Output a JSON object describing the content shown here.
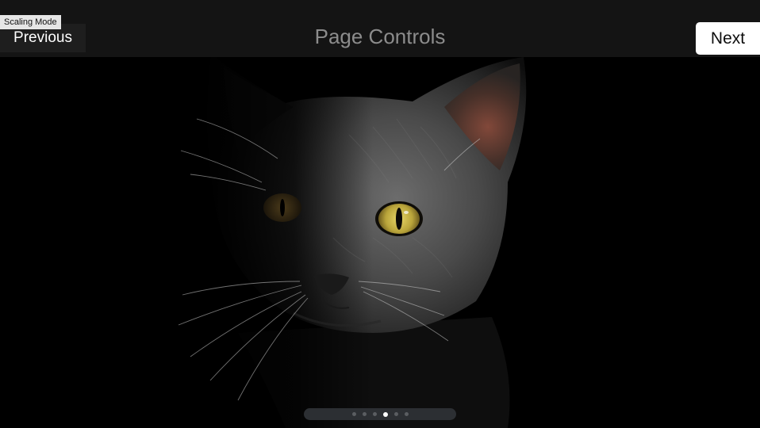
{
  "header": {
    "scaling_mode_label": "Scaling Mode",
    "title": "Page Controls",
    "previous_label": "Previous",
    "next_label": "Next"
  },
  "photo": {
    "subject": "black-cat-photo"
  },
  "page_indicator": {
    "page_count": 6,
    "current_page": 4
  },
  "colors": {
    "header_bg": "#141414",
    "title": "#8c8c8c",
    "indicator_bg": "#2c2f33",
    "active_dot": "#ffffff",
    "inactive_dot": "#5a5d61"
  }
}
